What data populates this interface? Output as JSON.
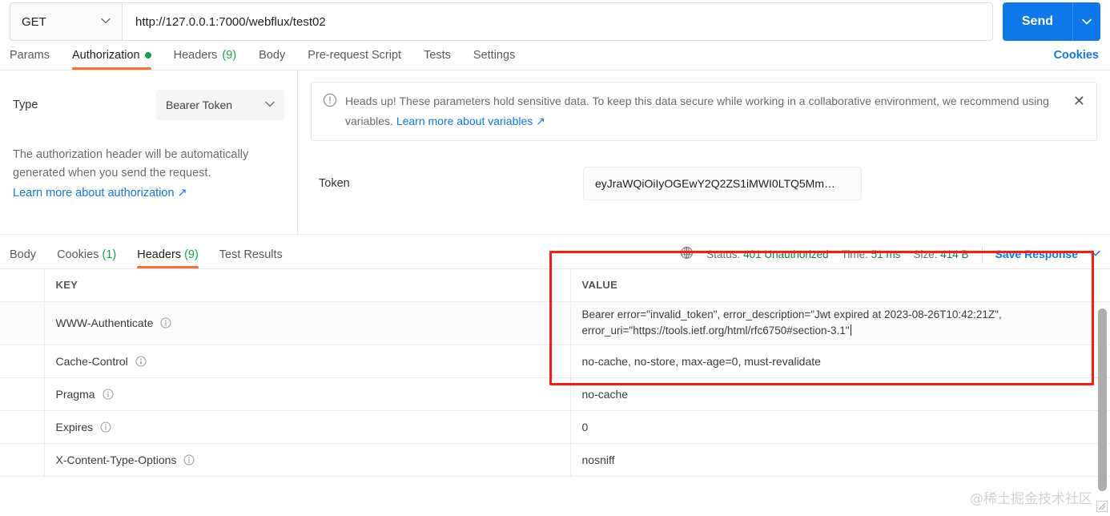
{
  "request": {
    "method": "GET",
    "url": "http://127.0.0.1:7000/webflux/test02",
    "send_label": "Send",
    "tabs": [
      {
        "label": "Params",
        "badge": "",
        "dot": false,
        "active": false
      },
      {
        "label": "Authorization",
        "badge": "",
        "dot": true,
        "active": true
      },
      {
        "label": "Headers",
        "badge": "(9)",
        "dot": false,
        "active": false
      },
      {
        "label": "Body",
        "badge": "",
        "dot": false,
        "active": false
      },
      {
        "label": "Pre-request Script",
        "badge": "",
        "dot": false,
        "active": false
      },
      {
        "label": "Tests",
        "badge": "",
        "dot": false,
        "active": false
      },
      {
        "label": "Settings",
        "badge": "",
        "dot": false,
        "active": false
      }
    ],
    "cookies_link": "Cookies"
  },
  "auth": {
    "type_label": "Type",
    "type_value": "Bearer Token",
    "description": "The authorization header will be automatically generated when you send the request.",
    "learn_more": "Learn more about authorization ↗",
    "banner": {
      "text": "Heads up! These parameters hold sensitive data. To keep this data secure while working in a collaborative environment, we recommend using variables. ",
      "link": "Learn more about variables ↗",
      "close": "✕"
    },
    "token_label": "Token",
    "token_value": "eyJraWQiOiIyOGEwY2Q2ZS1iMWI0LTQ5Mm…"
  },
  "response": {
    "tabs": [
      {
        "label": "Body",
        "badge": "",
        "active": false
      },
      {
        "label": "Cookies",
        "badge": "(1)",
        "active": false
      },
      {
        "label": "Headers",
        "badge": "(9)",
        "active": true
      },
      {
        "label": "Test Results",
        "badge": "",
        "active": false
      }
    ],
    "status_label": "Status:",
    "status_value": "401 Unauthorized",
    "time_label": "Time:",
    "time_value": "51 ms",
    "size_label": "Size:",
    "size_value": "414 B",
    "save_response": "Save Response",
    "columns": {
      "key": "KEY",
      "value": "VALUE"
    },
    "rows": [
      {
        "key": "WWW-Authenticate",
        "value": "Bearer error=\"invalid_token\", error_description=\"Jwt expired at 2023-08-26T10:42:21Z\", error_uri=\"https://tools.ietf.org/html/rfc6750#section-3.1\"",
        "multiline": true
      },
      {
        "key": "Cache-Control",
        "value": "no-cache, no-store, max-age=0, must-revalidate",
        "multiline": false
      },
      {
        "key": "Pragma",
        "value": "no-cache",
        "multiline": false
      },
      {
        "key": "Expires",
        "value": "0",
        "multiline": false
      },
      {
        "key": "X-Content-Type-Options",
        "value": "nosniff",
        "multiline": false
      }
    ]
  },
  "watermark": "@稀土掘金技术社区",
  "colors": {
    "accent_orange": "#ff6c37",
    "brand_blue": "#0e77ea",
    "status_green": "#1a7f37",
    "annotation_red": "#fc1b12"
  }
}
